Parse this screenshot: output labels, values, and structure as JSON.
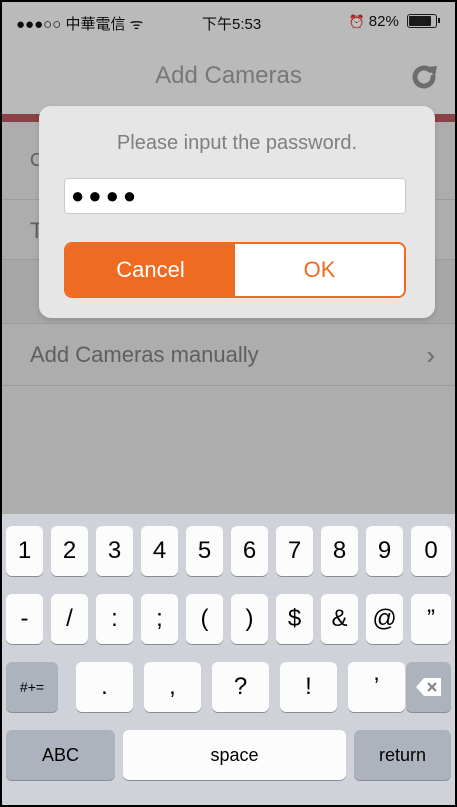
{
  "status": {
    "carrier": "●●●○○ 中華電信",
    "wifi": "ᯤ",
    "time": "下午5:53",
    "alarm": "⏰",
    "battery": "82%"
  },
  "nav": {
    "title": "Add Cameras",
    "refresh_icon": "refresh-icon"
  },
  "list": {
    "row1_label": "C",
    "row2_label": "T",
    "row3_label": "Add Cameras manually",
    "chevron": "›"
  },
  "dialog": {
    "prompt": "Please input the password.",
    "password_value": "●●●●",
    "cancel_label": "Cancel",
    "ok_label": "OK"
  },
  "keyboard": {
    "row1": [
      "1",
      "2",
      "3",
      "4",
      "5",
      "6",
      "7",
      "8",
      "9",
      "0"
    ],
    "row2": [
      "-",
      "/",
      ":",
      ";",
      "(",
      ")",
      "$",
      "&",
      "@",
      "”"
    ],
    "row3_mode": "#+=",
    "row3": [
      ".",
      ",",
      "?",
      "!",
      "’"
    ],
    "backspace_icon": "backspace-icon",
    "abc": "ABC",
    "space": "space",
    "return": "return"
  },
  "colors": {
    "accent": "#ef6b22",
    "redbar": "#b0535a"
  }
}
